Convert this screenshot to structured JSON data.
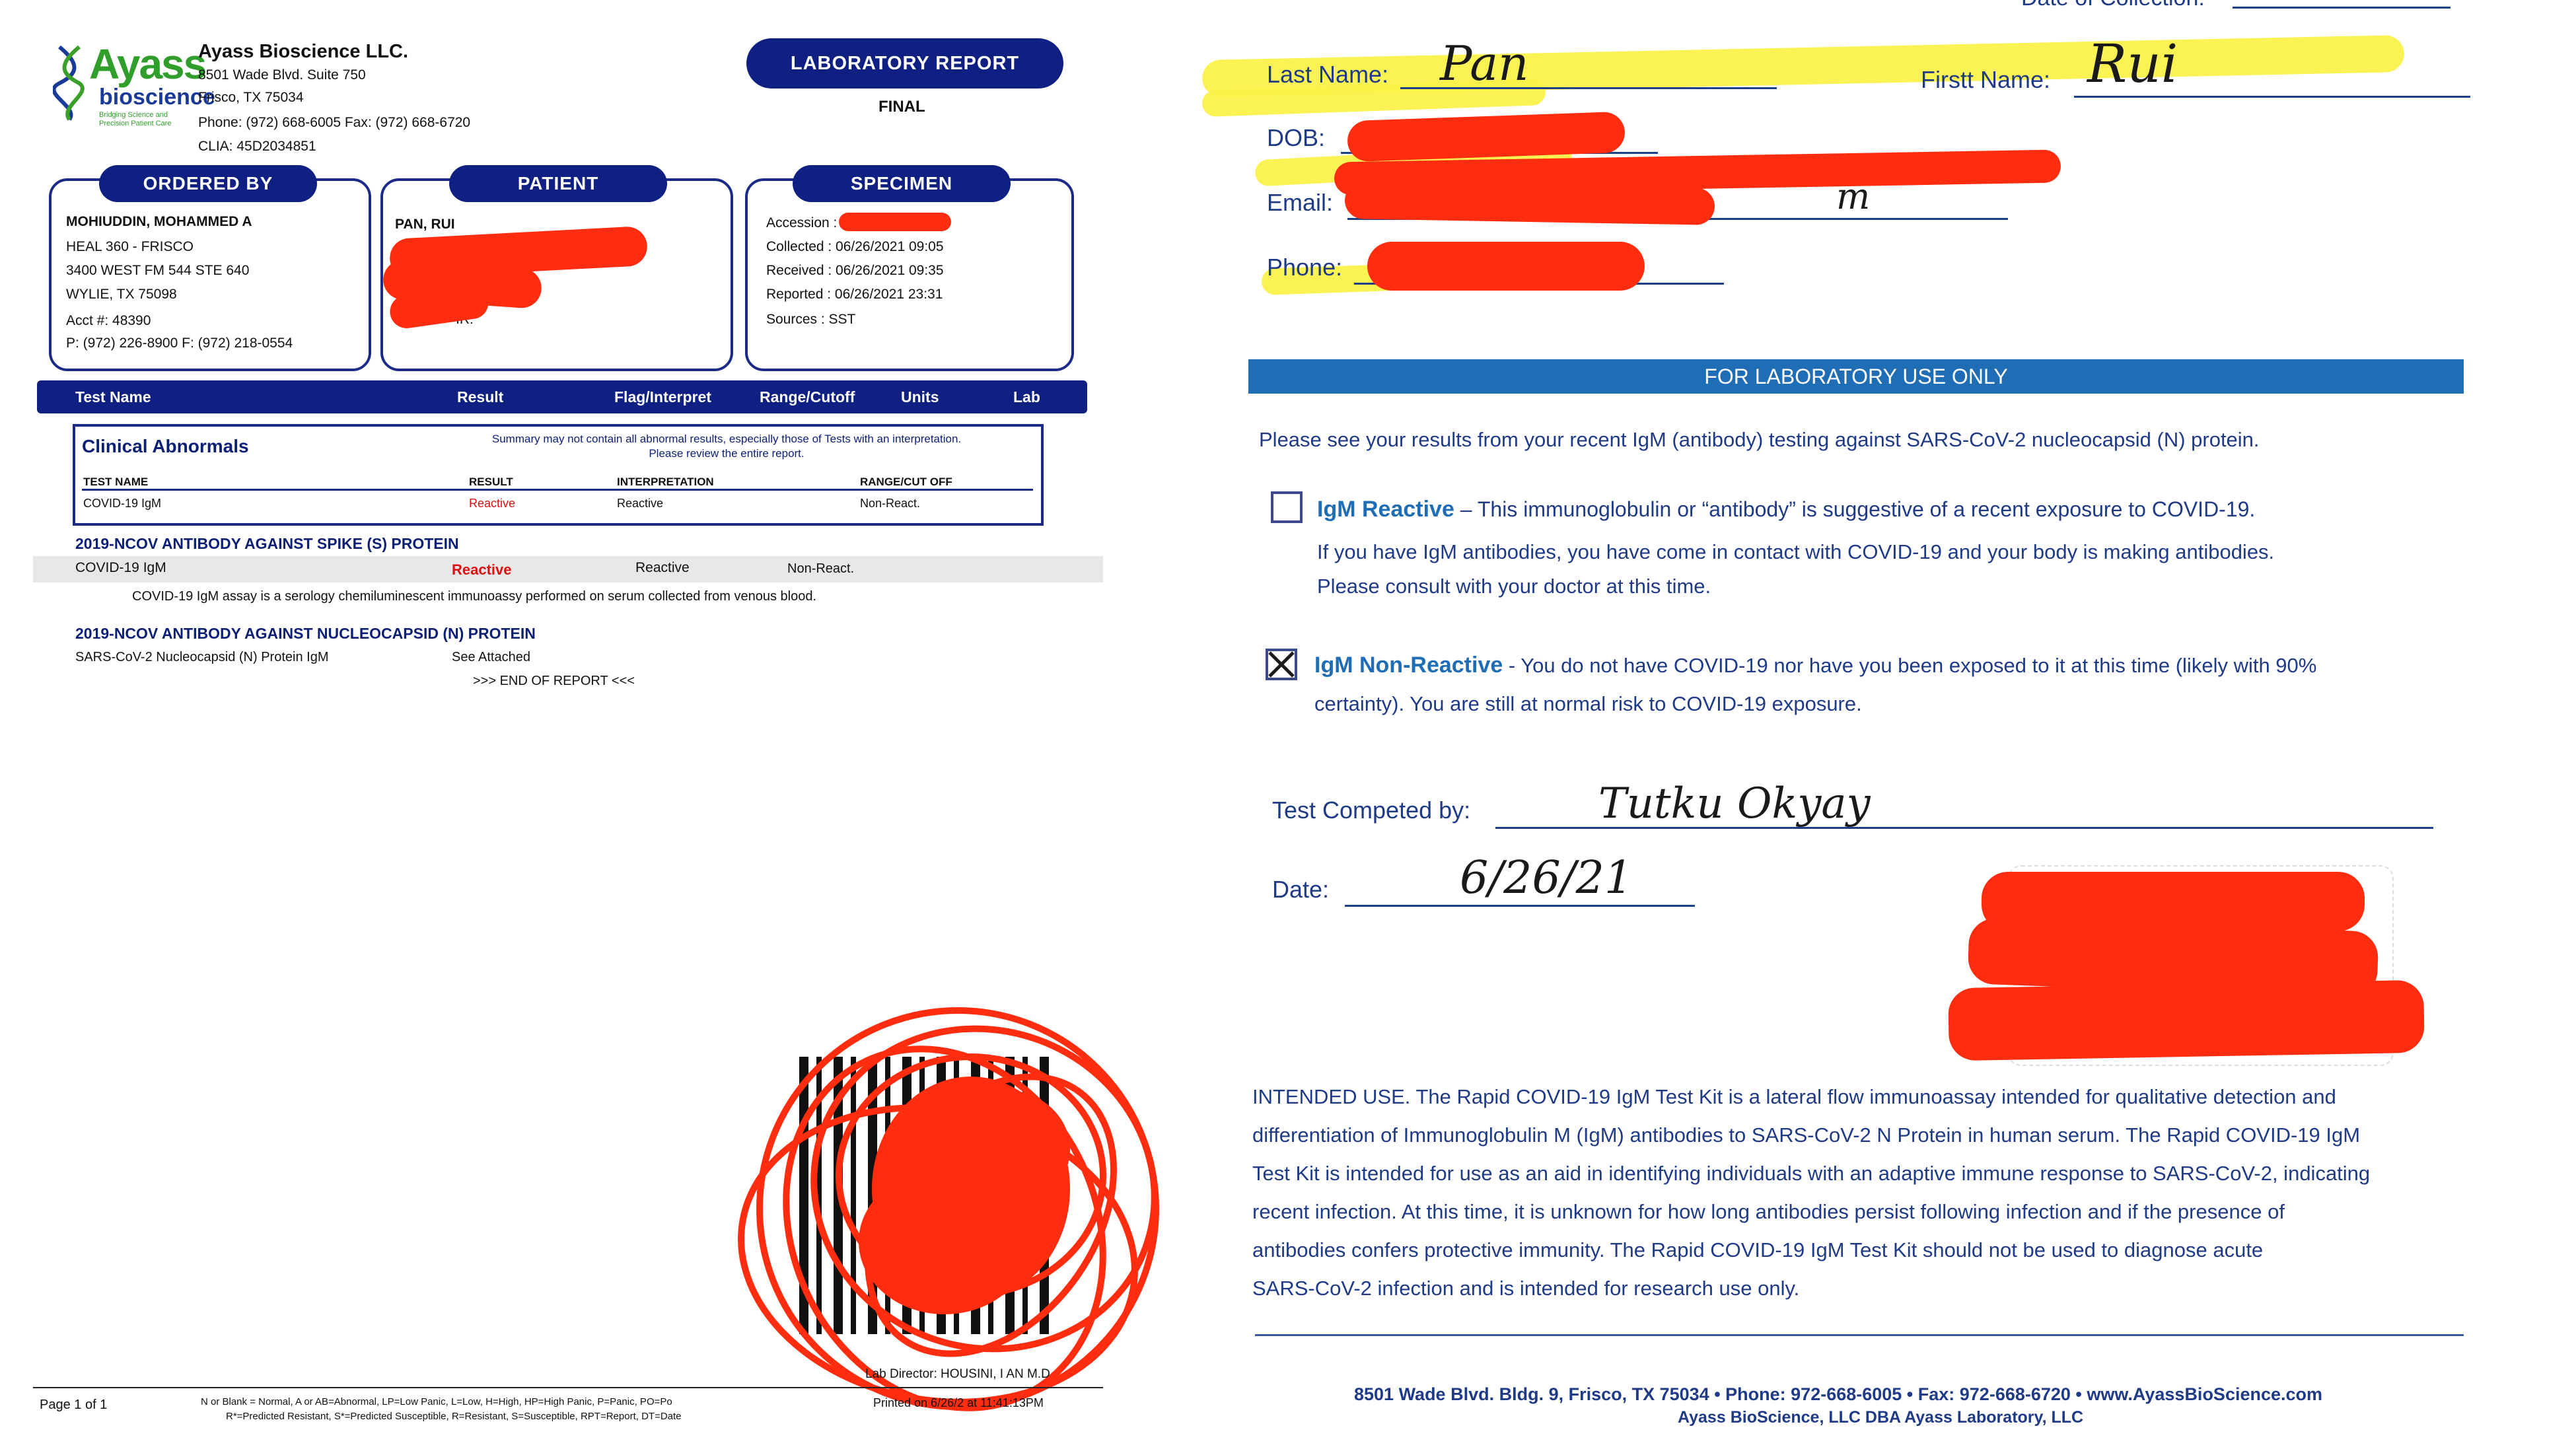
{
  "left": {
    "lab": {
      "logo": "Ayass",
      "logo_sub": "bioscience",
      "logo_tag": "Bridging Science and Precision Patient Care",
      "name": "Ayass Bioscience LLC.",
      "address1": "8501 Wade Blvd. Suite 750",
      "address2": "Frisco, TX 75034",
      "phone": "Phone: (972) 668-6005  Fax: (972) 668-6720",
      "clia": "CLIA: 45D2034851"
    },
    "report_title": "LABORATORY REPORT",
    "report_status": "FINAL",
    "ordered_by": {
      "header": "ORDERED BY",
      "name": "MOHIUDDIN, MOHAMMED A",
      "practice": "HEAL 360 - FRISCO",
      "street": "3400 WEST FM 544 STE 640",
      "city": "WYLIE, TX 75098",
      "acct": "Acct #: 48390",
      "phone": "P: (972) 226-8900 F: (972) 218-0554"
    },
    "patient": {
      "header": "PATIENT",
      "name": "PAN, RUI",
      "partial": "IR:"
    },
    "specimen": {
      "header": "SPECIMEN",
      "accession": "Accession :",
      "collected": "Collected :    06/26/2021 09:05",
      "received": "Received : 06/26/2021 09:35",
      "reported": "Reported : 06/26/2021 23:31",
      "sources": "Sources  :    SST"
    },
    "columns": {
      "test_name": "Test Name",
      "result": "Result",
      "flag": "Flag/Interpret",
      "range": "Range/Cutoff",
      "units": "Units",
      "lab": "Lab"
    },
    "clinical": {
      "title": "Clinical Abnormals",
      "note": "Summary may not contain all abnormal results, especially those of Tests with an interpretation. Please review the entire report.",
      "h_test": "TEST NAME",
      "h_result": "RESULT",
      "h_interp": "INTERPRETATION",
      "h_range": "RANGE/CUT OFF",
      "row_test": "COVID-19 IgM",
      "row_result": "Reactive",
      "row_interp": "Reactive",
      "row_range": "Non-React."
    },
    "section1": {
      "title": "2019-NCOV ANTIBODY AGAINST SPIKE (S) PROTEIN",
      "test": "COVID-19 IgM",
      "result": "Reactive",
      "interp": "Reactive",
      "range": "Non-React.",
      "note": "COVID-19 IgM assay is a serology chemiluminescent immunoassy performed on serum collected from venous blood."
    },
    "section2": {
      "title": "2019-NCOV ANTIBODY AGAINST NUCLEOCAPSID (N) PROTEIN",
      "test": "SARS-CoV-2 Nucleocapsid (N) Protein IgM",
      "result": "See Attached"
    },
    "end": ">>> END OF REPORT <<<",
    "director": "Lab Director: HOUSINI, I   AN M.D",
    "page": "Page 1 of 1",
    "legend1": "N or Blank = Normal, A or AB=Abnormal, LP=Low Panic, L=Low, H=High, HP=High Panic, P=Panic, PO=Po",
    "legend2": "R*=Predicted Resistant, S*=Predicted Susceptible, R=Resistant, S=Susceptible, RPT=Report, DT=Date",
    "printed": "Printed on 6/26/2  at 11:41:13PM"
  },
  "right": {
    "top_partial": "Date of Collection:",
    "last_name_label": "Last Name:",
    "last_name": "Pan",
    "first_name_label": "Firstt Name:",
    "first_name": "Rui",
    "dob_label": "DOB:",
    "email_label": "Email:",
    "email_partial": "m",
    "phone_label": "Phone:",
    "lab_use": "FOR LABORATORY USE ONLY",
    "intro": "Please see your results from your recent IgM (antibody) testing against SARS-CoV-2 nucleocapsid (N) protein.",
    "reactive_title": "IgM Reactive",
    "reactive_text1": " – This immunoglobulin or “antibody” is suggestive of a recent exposure to COVID-19.",
    "reactive_text2": "If you have IgM antibodies, you have come in contact with COVID-19 and your body is making antibodies.",
    "reactive_text3": "Please consult with your doctor at this time.",
    "nonreactive_title": "IgM Non-Reactive",
    "nonreactive_text1": " - You do not have COVID-19 nor have you been exposed to it at this time (likely with 90%",
    "nonreactive_text2": "certainty). You are still at normal risk to COVID-19 exposure.",
    "completed_label": "Test Competed by:",
    "completed_sig": "Tutku Okyay",
    "date_label": "Date:",
    "date_value": "6/26/21",
    "intended": [
      "INTENDED USE. The Rapid COVID-19 IgM Test Kit is a lateral flow immunoassay intended for qualitative detection and",
      "differentiation of Immunoglobulin M (IgM) antibodies to SARS-CoV-2 N Protein in human serum. The Rapid COVID-19 IgM",
      "Test Kit is intended for use as an aid in identifying individuals with an adaptive immune response to SARS-CoV-2, indicating",
      "recent infection. At this time, it is unknown for how long antibodies persist following infection and if the presence of",
      "antibodies confers protective immunity. The Rapid COVID-19 IgM Test Kit should not be used to diagnose acute",
      "SARS-CoV-2 infection and is intended for research use only."
    ],
    "footer1": "8501 Wade Blvd. Bldg. 9, Frisco, TX 75034 • Phone: 972-668-6005 • Fax: 972-668-6720 • www.AyassBioScience.com",
    "footer2": "Ayass BioScience, LLC DBA Ayass Laboratory, LLC"
  },
  "colors": {
    "navy": "#0f1f82",
    "redaction": "#ff2d10",
    "highlight": "#fbf24a",
    "lab_blue": "#1f6db5",
    "reactive_red": "#e01010"
  }
}
